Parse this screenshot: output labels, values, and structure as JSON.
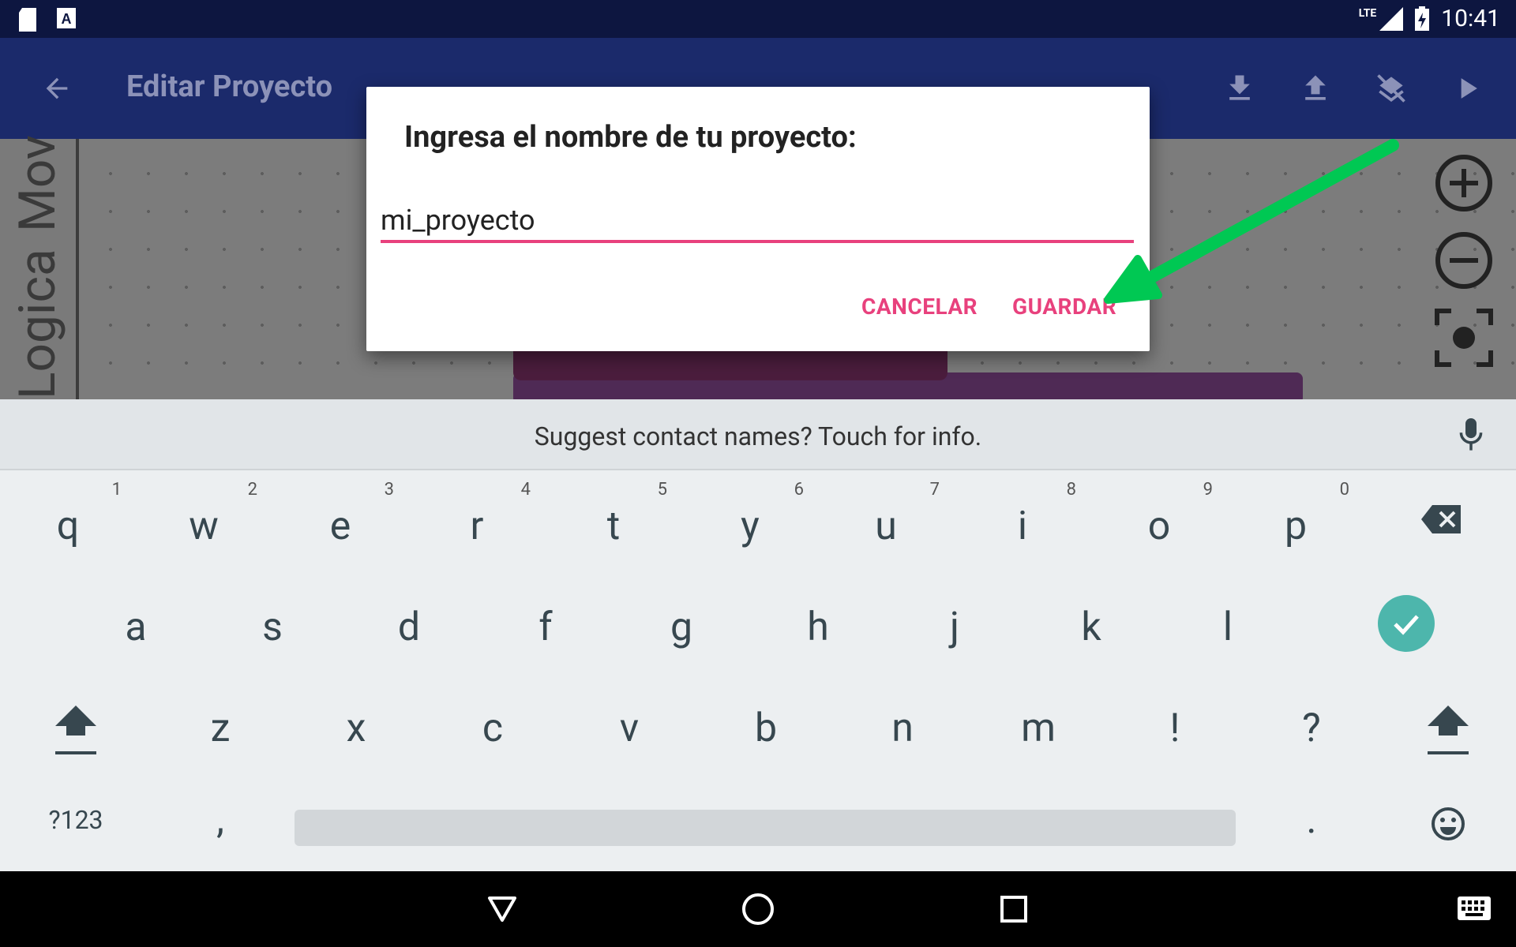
{
  "status_bar": {
    "time": "10:41",
    "network": "LTE",
    "left_icons": [
      "sd-card-icon",
      "keyboard-a-icon"
    ],
    "right_icons": [
      "signal-icon",
      "battery-icon"
    ]
  },
  "app_bar": {
    "title": "Editar Proyecto",
    "back_icon": "arrow-back-icon",
    "actions": [
      "download-icon",
      "upload-icon",
      "layers-clear-icon",
      "play-icon"
    ]
  },
  "workspace": {
    "flyout_labels": [
      "Mov",
      "Logica"
    ],
    "zoom_controls": [
      "zoom-in-icon",
      "zoom-out-icon",
      "recenter-icon"
    ]
  },
  "dialog": {
    "title": "Ingresa el nombre de tu proyecto:",
    "input_value": "mi_proyecto",
    "cancel_label": "CANCELAR",
    "save_label": "GUARDAR"
  },
  "keyboard": {
    "suggestion_text": "Suggest contact names? Touch for info.",
    "row1": [
      "q",
      "w",
      "e",
      "r",
      "t",
      "y",
      "u",
      "i",
      "o",
      "p"
    ],
    "row1_hints": [
      "1",
      "2",
      "3",
      "4",
      "5",
      "6",
      "7",
      "8",
      "9",
      "0"
    ],
    "row2": [
      "a",
      "s",
      "d",
      "f",
      "g",
      "h",
      "j",
      "k",
      "l"
    ],
    "row3": [
      "z",
      "x",
      "c",
      "v",
      "b",
      "n",
      "m",
      "!",
      "?"
    ],
    "symbols_label": "?123",
    "comma": ",",
    "period": "."
  },
  "colors": {
    "accent": "#e8417d",
    "app_bar": "#1b2a6b",
    "status_bar": "#0d1640",
    "enter_key": "#4db6ac",
    "arrow": "#00c853"
  }
}
